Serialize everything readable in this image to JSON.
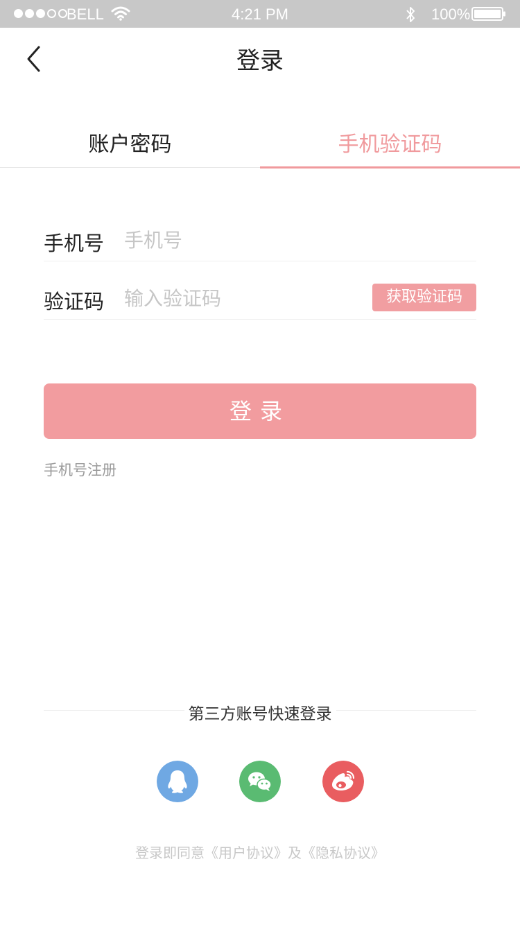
{
  "status_bar": {
    "carrier": "BELL",
    "time": "4:21 PM",
    "battery": "100%",
    "signal_bars_filled": 3,
    "signal_bars_total": 5
  },
  "nav": {
    "title": "登录",
    "back_icon": "chevron-left-icon"
  },
  "tabs": [
    {
      "label": "账户密码",
      "active": false
    },
    {
      "label": "手机验证码",
      "active": true
    }
  ],
  "form": {
    "phone_label": "手机号",
    "phone_placeholder": "手机号",
    "code_label": "验证码",
    "code_placeholder": "输入验证码",
    "get_code_label": "获取验证码"
  },
  "login_button": "登录",
  "register_link": "手机号注册",
  "third_party": {
    "title": "第三方账号快速登录",
    "providers": [
      {
        "name": "qq",
        "icon": "qq-icon",
        "color": "#6fa8e3"
      },
      {
        "name": "wechat",
        "icon": "wechat-icon",
        "color": "#5abb72"
      },
      {
        "name": "weibo",
        "icon": "weibo-icon",
        "color": "#e95d60"
      }
    ]
  },
  "agreement": {
    "prefix": "登录即同意",
    "user_agreement": "《用户协议》",
    "connector": "及",
    "privacy_policy": "《隐私协议》"
  },
  "colors": {
    "accent": "#f09a9d",
    "status_bar_bg": "#c8c8c8",
    "placeholder": "#c6c6c6"
  }
}
